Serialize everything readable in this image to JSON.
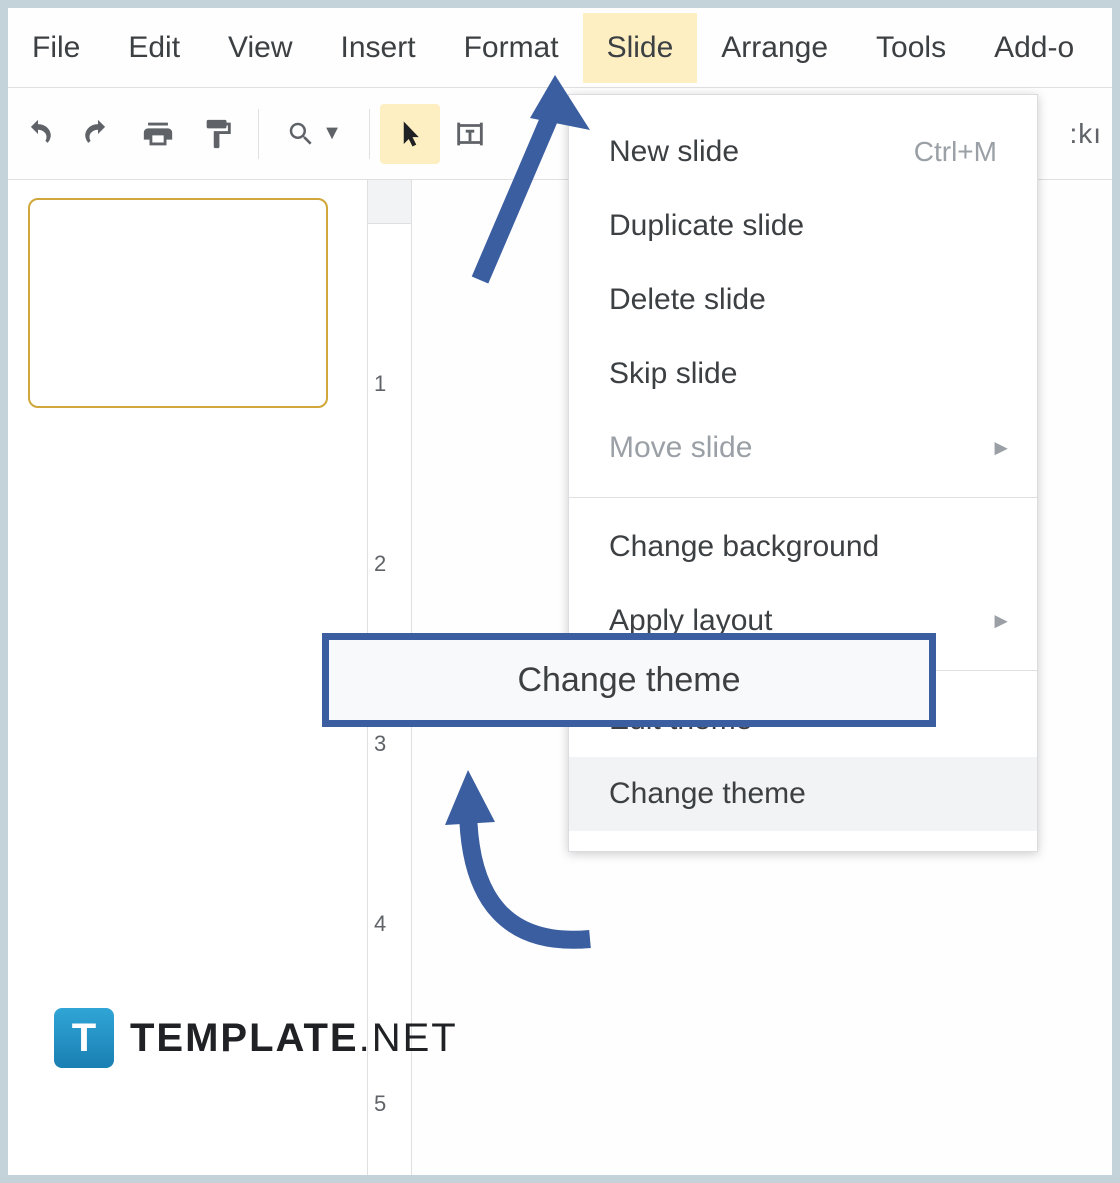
{
  "menubar": {
    "items": [
      {
        "label": "File"
      },
      {
        "label": "Edit"
      },
      {
        "label": "View"
      },
      {
        "label": "Insert"
      },
      {
        "label": "Format"
      },
      {
        "label": "Slide"
      },
      {
        "label": "Arrange"
      },
      {
        "label": "Tools"
      },
      {
        "label": "Add-o"
      }
    ],
    "active_index": 5
  },
  "toolbar": {
    "cutoff_right": ":kı"
  },
  "dropdown": {
    "items": [
      {
        "label": "New slide",
        "shortcut": "Ctrl+M"
      },
      {
        "label": "Duplicate slide"
      },
      {
        "label": "Delete slide"
      },
      {
        "label": "Skip slide"
      },
      {
        "label": "Move slide",
        "disabled": true,
        "submenu": true
      },
      {
        "separator": true
      },
      {
        "label": "Change background"
      },
      {
        "label": "Apply layout",
        "submenu": true
      },
      {
        "separator": true
      },
      {
        "label": "Edit theme"
      },
      {
        "label": "Change theme",
        "hover": true
      }
    ]
  },
  "callout": {
    "label": "Change theme"
  },
  "ruler": {
    "labels": [
      "1",
      "2",
      "3",
      "4",
      "5"
    ]
  },
  "watermark": {
    "icon_letter": "T",
    "brand": "TEMPLATE",
    "suffix": ".NET"
  }
}
